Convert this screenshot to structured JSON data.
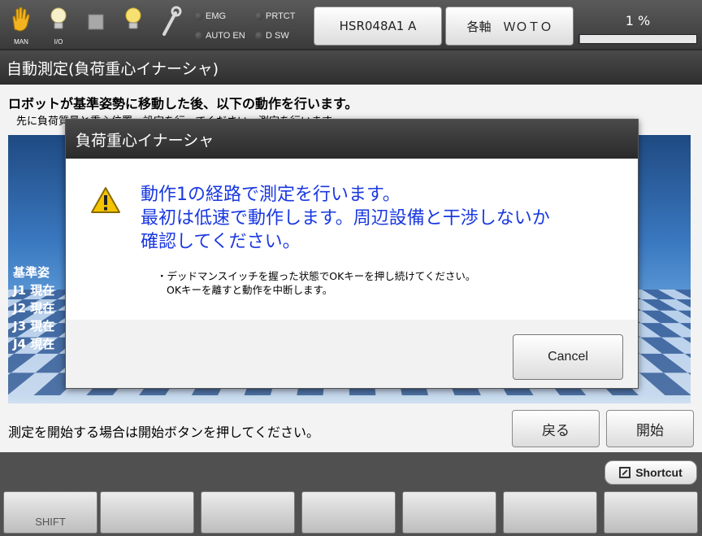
{
  "status_bar": {
    "icons": [
      {
        "icon": "hand-icon",
        "label": "MAN"
      },
      {
        "icon": "bulb-icon",
        "label": "I/O"
      },
      {
        "icon": "square-icon",
        "label": ""
      },
      {
        "icon": "bulb-icon",
        "label": ""
      },
      {
        "icon": "wrench-icon",
        "label": ""
      }
    ],
    "indicators": {
      "emg": "EMG",
      "prtct": "PRTCT",
      "auto_en": "AUTO EN",
      "dsw": "D SW"
    },
    "robot_button": "HSR048A1 A",
    "axis_button": "各軸　ＷＯＴＯ",
    "progress": {
      "text": "1 %",
      "value": 1
    }
  },
  "title": "自動測定(負荷重心イナーシャ)",
  "main": {
    "instruction": "ロボットが基準姿勢に移動した後、以下の動作を行います。",
    "sub_instruction": "先に負荷質量と重心位置・設定を行ってください。測定を行います。",
    "position_info": [
      "基準姿",
      "J1 現在",
      "J2 現在",
      "J3 現在",
      "J4 現在"
    ],
    "bottom_text": "測定を開始する場合は開始ボタンを押してください。",
    "back_button": "戻る",
    "start_button": "開始"
  },
  "dialog": {
    "title": "負荷重心イナーシャ",
    "message_lines": [
      "動作1の経路で測定を行います。",
      "最初は低速で動作します。周辺設備と干渉しないか",
      "確認してください。"
    ],
    "note_lines": [
      "・デッドマンスイッチを握った状態でOKキーを押し続けてください。",
      "OKキーを離すと動作を中断します。"
    ],
    "cancel_button": "Cancel"
  },
  "function_keys": {
    "shortcut": "Shortcut",
    "keys": [
      "SHIFT",
      "",
      "",
      "",
      "",
      "",
      ""
    ]
  }
}
